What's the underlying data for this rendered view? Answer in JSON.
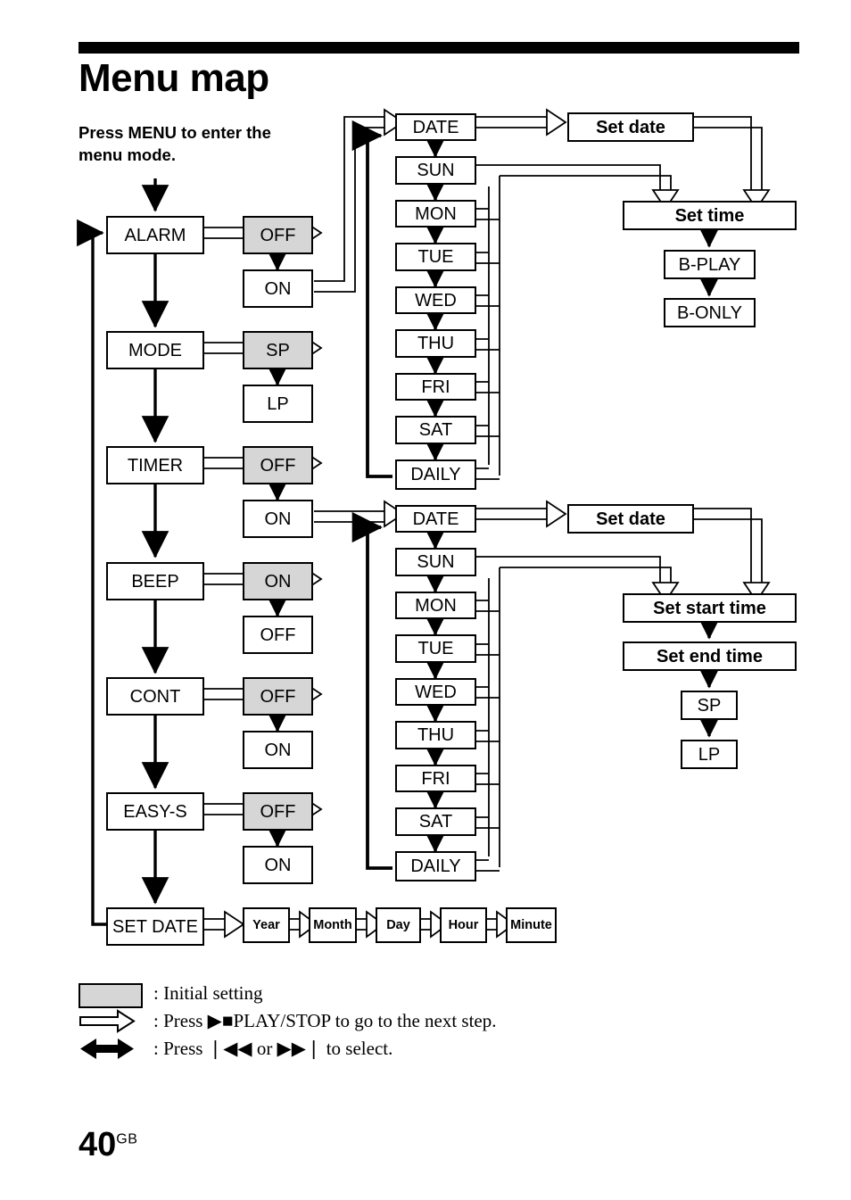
{
  "page": {
    "title": "Menu map",
    "intro": "Press MENU to enter the menu mode.",
    "number": "40",
    "number_suffix": "GB"
  },
  "menu_column": [
    {
      "label": "ALARM",
      "options": [
        {
          "label": "OFF",
          "initial": true
        },
        {
          "label": "ON",
          "initial": false
        }
      ]
    },
    {
      "label": "MODE",
      "options": [
        {
          "label": "SP",
          "initial": true
        },
        {
          "label": "LP",
          "initial": false
        }
      ]
    },
    {
      "label": "TIMER",
      "options": [
        {
          "label": "OFF",
          "initial": true
        },
        {
          "label": "ON",
          "initial": false
        }
      ]
    },
    {
      "label": "BEEP",
      "options": [
        {
          "label": "ON",
          "initial": true
        },
        {
          "label": "OFF",
          "initial": false
        }
      ]
    },
    {
      "label": "CONT",
      "options": [
        {
          "label": "OFF",
          "initial": true
        },
        {
          "label": "ON",
          "initial": false
        }
      ]
    },
    {
      "label": "EASY-S",
      "options": [
        {
          "label": "OFF",
          "initial": true
        },
        {
          "label": "ON",
          "initial": false
        }
      ]
    },
    {
      "label": "SET DATE",
      "options": []
    }
  ],
  "set_date_steps": [
    "Year",
    "Month",
    "Day",
    "Hour",
    "Minute"
  ],
  "alarm_group": {
    "days": [
      "DATE",
      "SUN",
      "MON",
      "TUE",
      "WED",
      "THU",
      "FRI",
      "SAT",
      "DAILY"
    ],
    "set_date": "Set date",
    "set_time": "Set time",
    "time_options": [
      "B-PLAY",
      "B-ONLY"
    ]
  },
  "timer_group": {
    "days": [
      "DATE",
      "SUN",
      "MON",
      "TUE",
      "WED",
      "THU",
      "FRI",
      "SAT",
      "DAILY"
    ],
    "set_date": "Set date",
    "set_start_time": "Set start time",
    "set_end_time": "Set end time",
    "mode_options": [
      "SP",
      "LP"
    ]
  },
  "legend": [
    {
      "glyph": "swatch",
      "text": ": Initial setting"
    },
    {
      "glyph": "hollow-arrow",
      "text": ":   Press ▶■PLAY/STOP to go to the next step."
    },
    {
      "glyph": "double-arrow",
      "text": ":   Press ❘◀◀ or ▶▶❘ to select."
    }
  ],
  "colors": {
    "initial_setting_fill": "#d6d6d6",
    "line": "#000000",
    "background": "#ffffff"
  }
}
